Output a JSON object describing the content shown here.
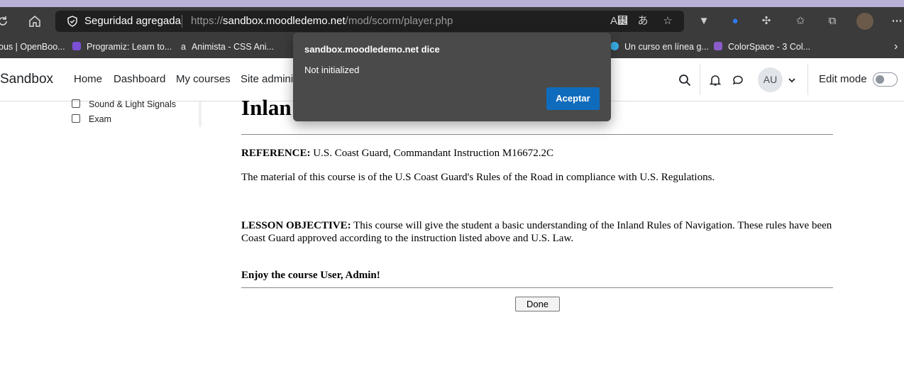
{
  "browser": {
    "security_label": "Seguridad agregada",
    "url_scheme": "https://",
    "url_host": "sandbox.moodledemo.net",
    "url_path": "/mod/scorm/player.php",
    "bookmarks": [
      {
        "label": "ous | OpenBoo...",
        "color": "#3b3b3b"
      },
      {
        "label": "Programiz: Learn to...",
        "color": "#7b4fd6"
      },
      {
        "label": "Animista - CSS Ani...",
        "color": "#3b3b3b"
      },
      {
        "label": "Un curso en línea g...",
        "color": "#3ab0e8"
      },
      {
        "label": "ColorSpace - 3 Col...",
        "color": "#8a5cc9"
      }
    ]
  },
  "moodle": {
    "brand": "Sandbox",
    "nav": [
      "Home",
      "Dashboard",
      "My courses",
      "Site admini"
    ],
    "avatar_initials": "AU",
    "edit_mode_label": "Edit mode"
  },
  "course_index": {
    "items": [
      "Sound & Light Signals",
      "Exam"
    ]
  },
  "scorm": {
    "title_fragment": "Inlan",
    "reference_label": "REFERENCE:",
    "reference_text": "U.S. Coast Guard, Commandant Instruction M16672.2C",
    "material_text": "The material of this course is of the U.S Coast Guard's Rules of the Road in compliance with U.S. Regulations.",
    "objective_label": "LESSON OBJECTIVE:",
    "objective_text": "This course will give the student a basic understanding of the Inland Rules of Navigation. These rules have been Coast Guard approved according to the instruction listed above and U.S. Law.",
    "enjoy_text": "Enjoy the course User, Admin!",
    "done_label": "Done"
  },
  "dialog": {
    "title": "sandbox.moodledemo.net dice",
    "message": "Not initialized",
    "button_label": "Aceptar",
    "button_color": "#0f6cbd"
  }
}
